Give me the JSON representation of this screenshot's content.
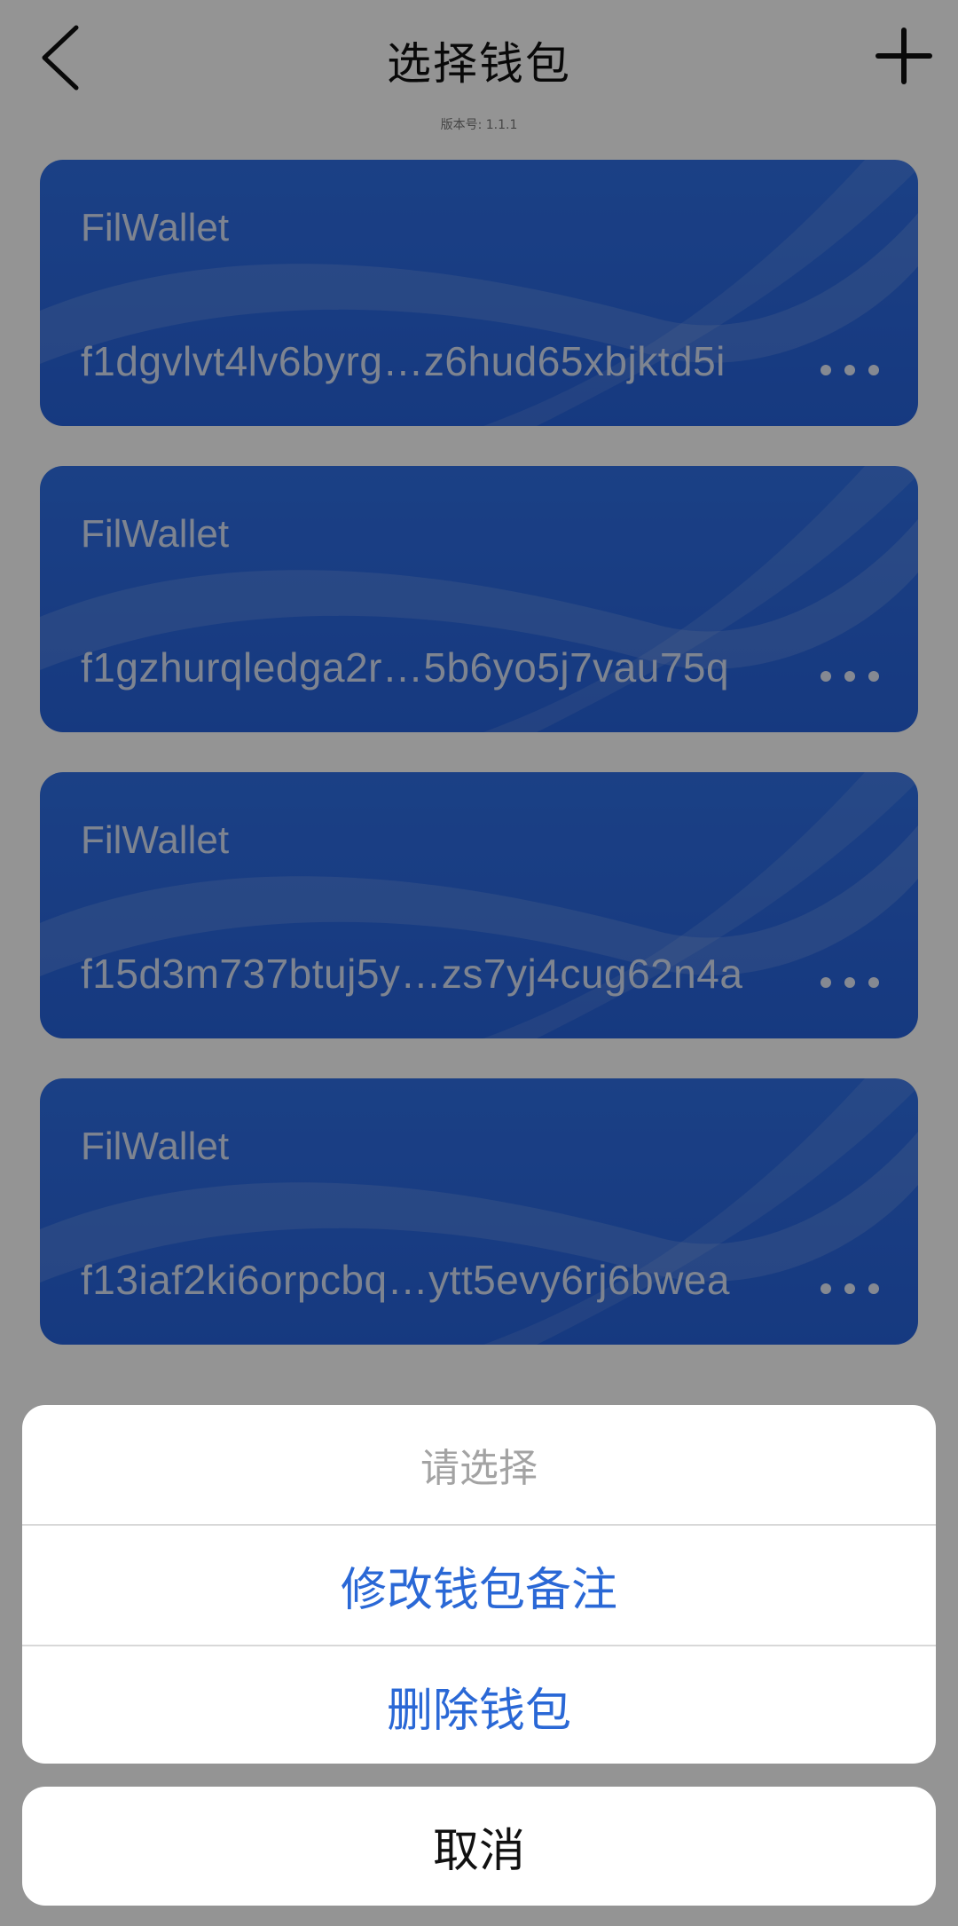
{
  "header": {
    "title": "选择钱包",
    "back_icon": "chevron-left-icon",
    "add_icon": "plus-icon",
    "version_label": "版本号: 1.1.1"
  },
  "wallets": [
    {
      "name": "FilWallet",
      "address": "f1dgvlvt4lv6byrg…z6hud65xbjktd5i"
    },
    {
      "name": "FilWallet",
      "address": "f1gzhurqledga2r…5b6yo5j7vau75q"
    },
    {
      "name": "FilWallet",
      "address": "f15d3m737btuj5y…zs7yj4cug62n4a"
    },
    {
      "name": "FilWallet",
      "address": "f13iaf2ki6orpcbq…ytt5evy6rj6bwea"
    }
  ],
  "action_sheet": {
    "title": "请选择",
    "actions": [
      {
        "label": "修改钱包备注"
      },
      {
        "label": "删除钱包"
      }
    ],
    "cancel_label": "取消"
  },
  "colors": {
    "card_blue": "#2f6fe6",
    "action_blue": "#2a68d6",
    "overlay": "rgba(0,0,0,0.42)"
  }
}
